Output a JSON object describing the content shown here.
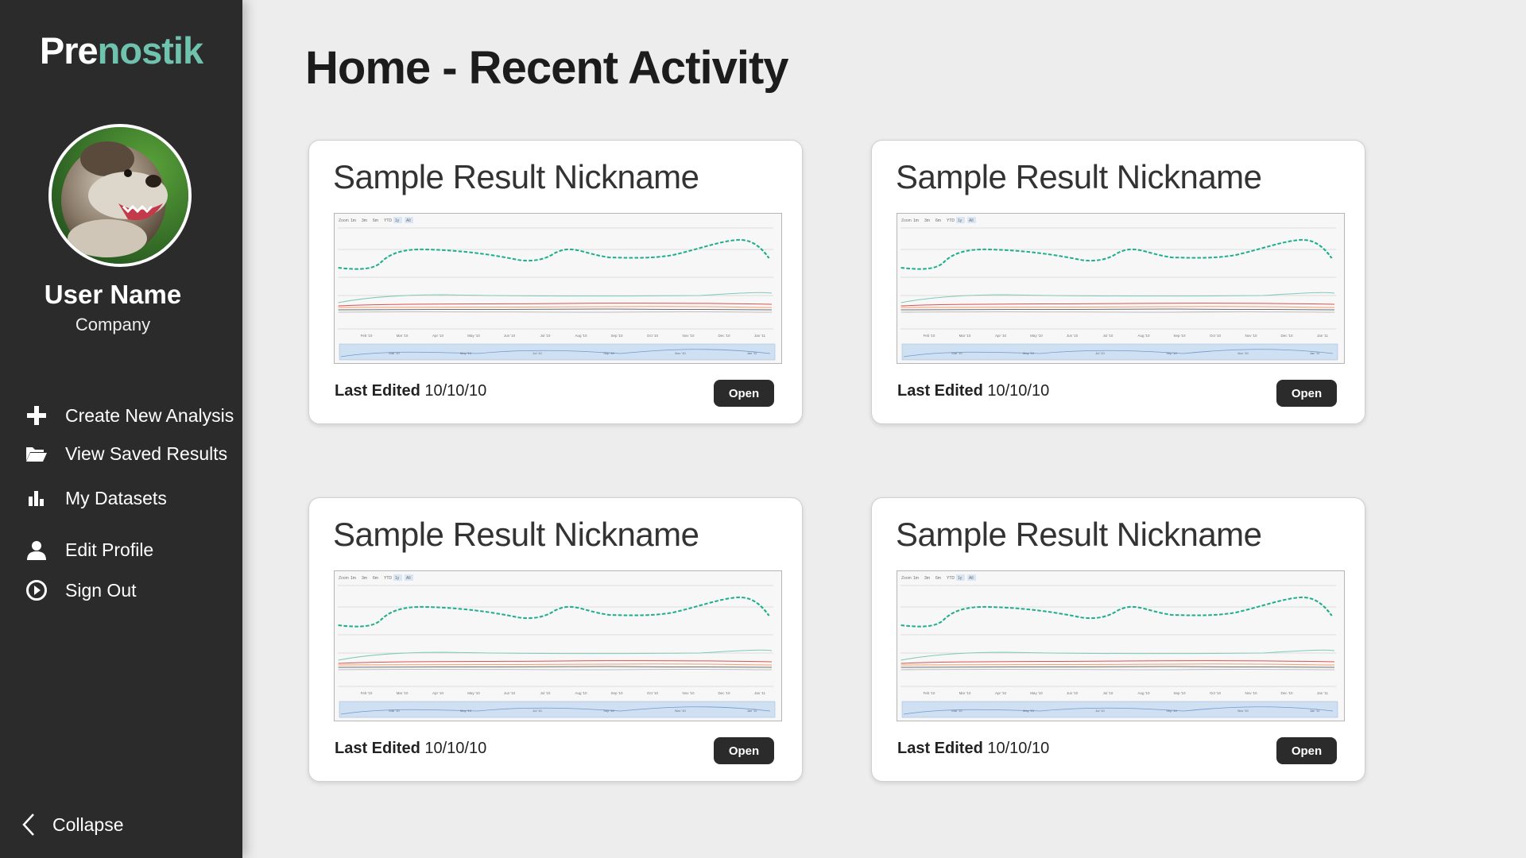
{
  "app": {
    "logo_part1": "Pre",
    "logo_part2": "nostik",
    "accent_color": "#6fc2ad",
    "sidebar_bg": "#2b2b2b"
  },
  "user": {
    "name": "User Name",
    "company": "Company"
  },
  "nav": {
    "create": {
      "label": "Create New Analysis",
      "icon": "plus-icon"
    },
    "saved": {
      "label": "View Saved Results",
      "icon": "folder-open-icon"
    },
    "datasets": {
      "label": "My Datasets",
      "icon": "bar-chart-icon"
    },
    "profile": {
      "label": "Edit Profile",
      "icon": "user-icon"
    },
    "signout": {
      "label": "Sign Out",
      "icon": "sign-out-icon"
    },
    "collapse": {
      "label": "Collapse",
      "icon": "chevron-left-icon"
    }
  },
  "page": {
    "title": "Home - Recent Activity"
  },
  "cards": [
    {
      "title": "Sample Result Nickname",
      "last_edited_label": "Last Edited",
      "last_edited_value": "10/10/10",
      "open_label": "Open"
    },
    {
      "title": "Sample Result Nickname",
      "last_edited_label": "Last Edited",
      "last_edited_value": "10/10/10",
      "open_label": "Open"
    },
    {
      "title": "Sample Result Nickname",
      "last_edited_label": "Last Edited",
      "last_edited_value": "10/10/10",
      "open_label": "Open"
    },
    {
      "title": "Sample Result Nickname",
      "last_edited_label": "Last Edited",
      "last_edited_value": "10/10/10",
      "open_label": "Open"
    }
  ],
  "thumbnail": {
    "zoom_label": "Zoom",
    "zoom_buttons": [
      "1m",
      "3m",
      "6m",
      "YTD",
      "1y",
      "All"
    ],
    "x_ticks": [
      "Feb '10",
      "Mar '10",
      "Apr '10",
      "May '10",
      "Jun '10",
      "Jul '10",
      "Aug '10",
      "Sep '10",
      "Oct '10",
      "Nov '10",
      "Dec '10",
      "Jan '11"
    ],
    "nav_ticks": [
      "Mar '10",
      "May '10",
      "Jul '10",
      "Sep '10",
      "Nov '10",
      "Jan '11"
    ],
    "series_colors": [
      "#1fae8a",
      "#7fcbb8",
      "#d9534f",
      "#f0a070",
      "#444444",
      "#aaaaaa"
    ]
  }
}
